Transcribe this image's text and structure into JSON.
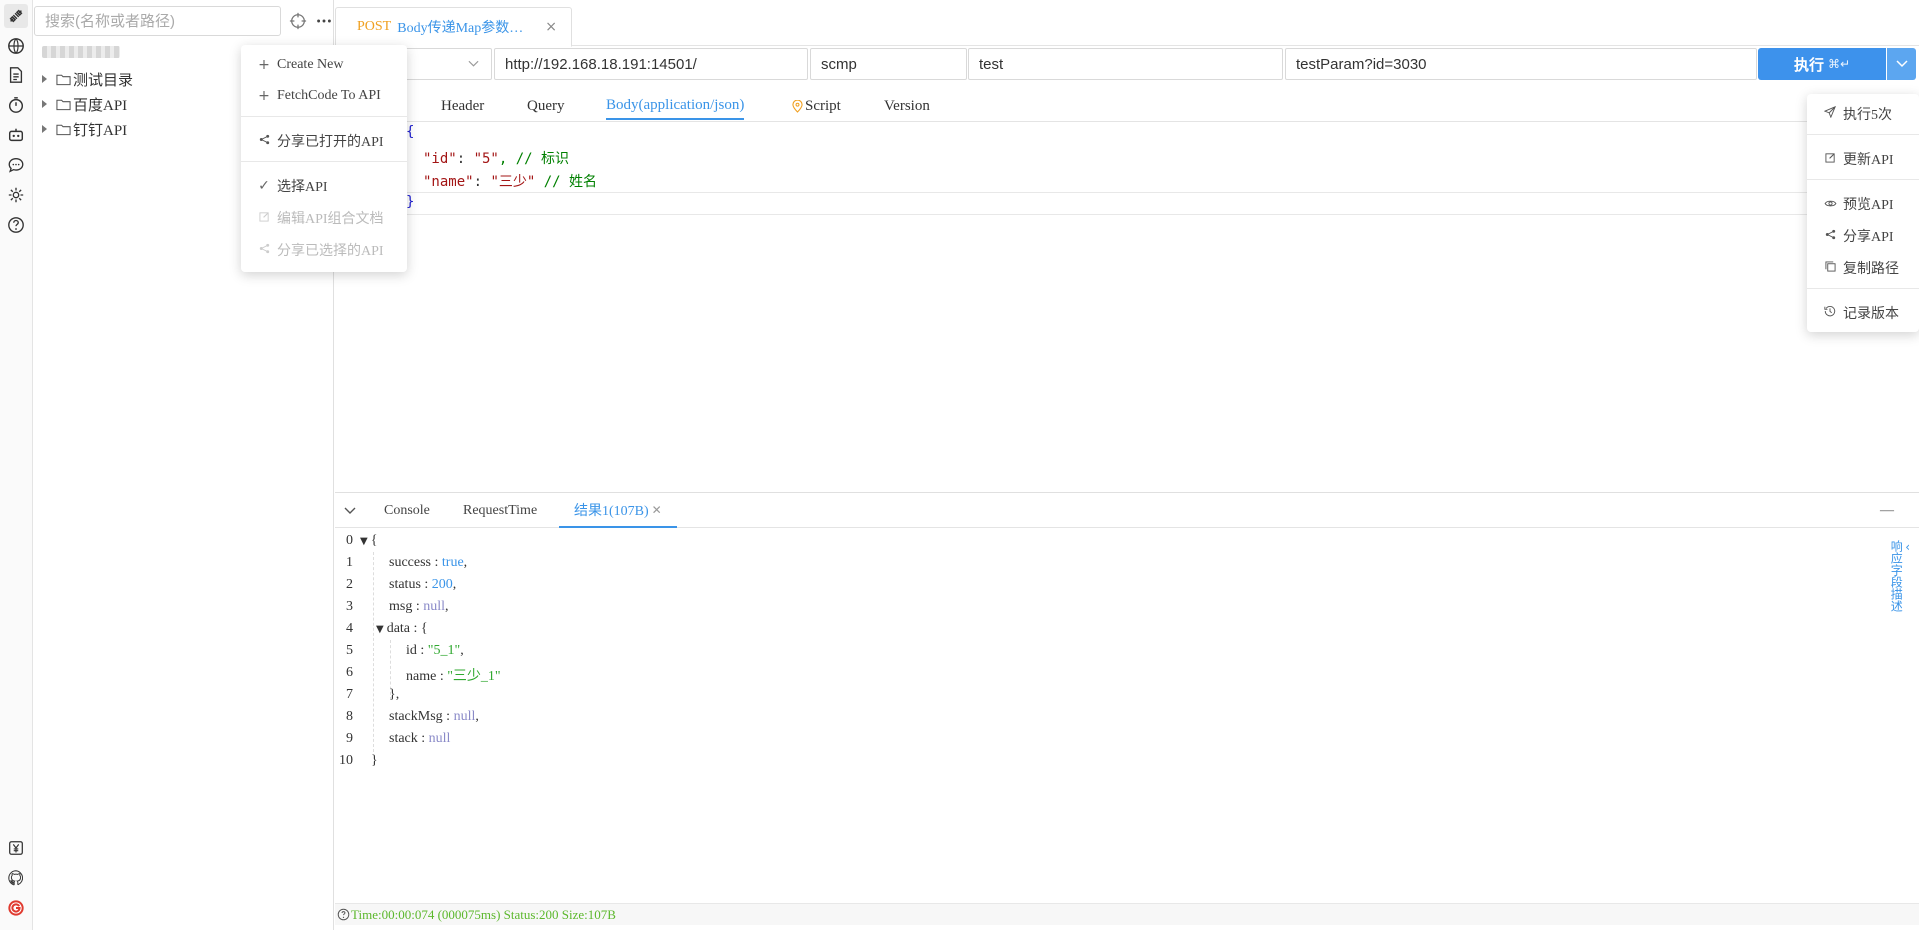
{
  "sidebar": {
    "search_placeholder": "搜索(名称或者路径)",
    "tree": [
      {
        "label": "测试目录"
      },
      {
        "label": "百度API"
      },
      {
        "label": "钉钉API"
      }
    ]
  },
  "left_menu": {
    "items": [
      "Create New",
      "FetchCode To API",
      "分享已打开的API",
      "选择API",
      "编辑API组合文档",
      "分享已选择的API"
    ]
  },
  "doc_tab": {
    "method": "POST",
    "title": "Body传递Map参数…",
    "close": "×"
  },
  "request": {
    "url": "http://192.168.18.191:14501/",
    "field2": "scmp",
    "field3": "test",
    "path": "testParam?id=3030",
    "execute_label": "执行",
    "execute_shortcut": "⌘↵"
  },
  "subtabs": [
    "Header",
    "Query",
    "Body(application/json)",
    "Script",
    "Version"
  ],
  "body_editor": {
    "open": "{",
    "line1_key": "\"id\"",
    "line1_colon": ": ",
    "line1_val": "\"5\"",
    "line1_comment": ", // 标识",
    "line2_key": "\"name\"",
    "line2_colon": ": ",
    "line2_val": "\"三少\"",
    "line2_comment": " // 姓名",
    "close": "}"
  },
  "right_menu": {
    "items": [
      "执行5次",
      "更新API",
      "预览API",
      "分享API",
      "复制路径",
      "记录版本"
    ]
  },
  "result_panel": {
    "tabs": [
      "Console",
      "RequestTime",
      "结果1(107B)"
    ],
    "minimize": "—",
    "side_label": "响应字段描述",
    "line_numbers": [
      "0",
      "1",
      "2",
      "3",
      "4",
      "5",
      "6",
      "7",
      "8",
      "9",
      "10"
    ],
    "json": {
      "open": "{",
      "success_key": "success",
      "success_val": "true",
      "status_key": "status",
      "status_val": "200",
      "msg_key": "msg",
      "msg_val": "null",
      "data_key": "data",
      "data_open": "{",
      "id_key": "id",
      "id_val": "\"5_1\"",
      "name_key": "name",
      "name_val": "\"三少_1\"",
      "data_close": "},",
      "stackMsg_key": "stackMsg",
      "stackMsg_val": "null",
      "stack_key": "stack",
      "stack_val": "null",
      "close": "}"
    },
    "status_line": "Time:00:00:074 (000075ms) Status:200 Size:107B"
  },
  "colors": {
    "accent": "#3a94e8",
    "method": "#f0a020",
    "ok": "#5cb82c"
  }
}
